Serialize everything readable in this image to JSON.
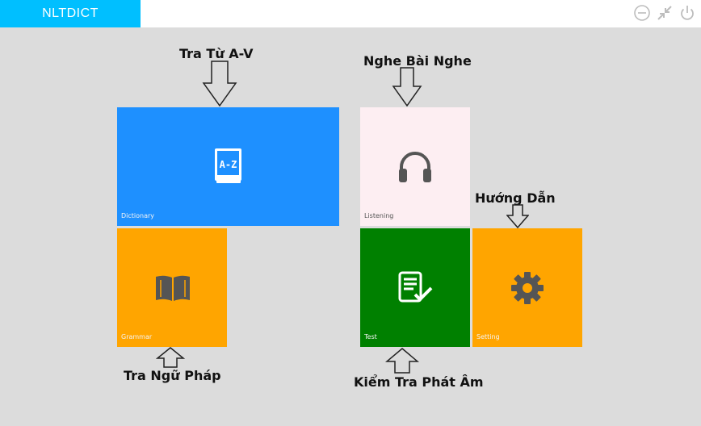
{
  "app": {
    "title": "NLTDICT"
  },
  "window_controls": [
    "minimize-icon",
    "collapse-icon",
    "power-icon"
  ],
  "tiles": {
    "dictionary": {
      "label": "Dictionary",
      "icon": "a-z-dictionary-icon",
      "color": "#1e90ff"
    },
    "listening": {
      "label": "Listening",
      "icon": "headphones-icon",
      "color": "#fdeef2"
    },
    "grammar": {
      "label": "Grammar",
      "icon": "open-book-icon",
      "color": "#ffa500"
    },
    "test": {
      "label": "Test",
      "icon": "checklist-icon",
      "color": "#008000"
    },
    "setting": {
      "label": "Setting",
      "icon": "gear-icon",
      "color": "#ffa500"
    }
  },
  "icon_text": {
    "az": "A-Z"
  },
  "callouts": {
    "dictionary": "Tra Từ A-V",
    "listening": "Nghe Bài Nghe",
    "setting": "Hướng Dẫn",
    "grammar": "Tra Ngữ Pháp",
    "test": "Kiểm Tra Phát Âm"
  }
}
